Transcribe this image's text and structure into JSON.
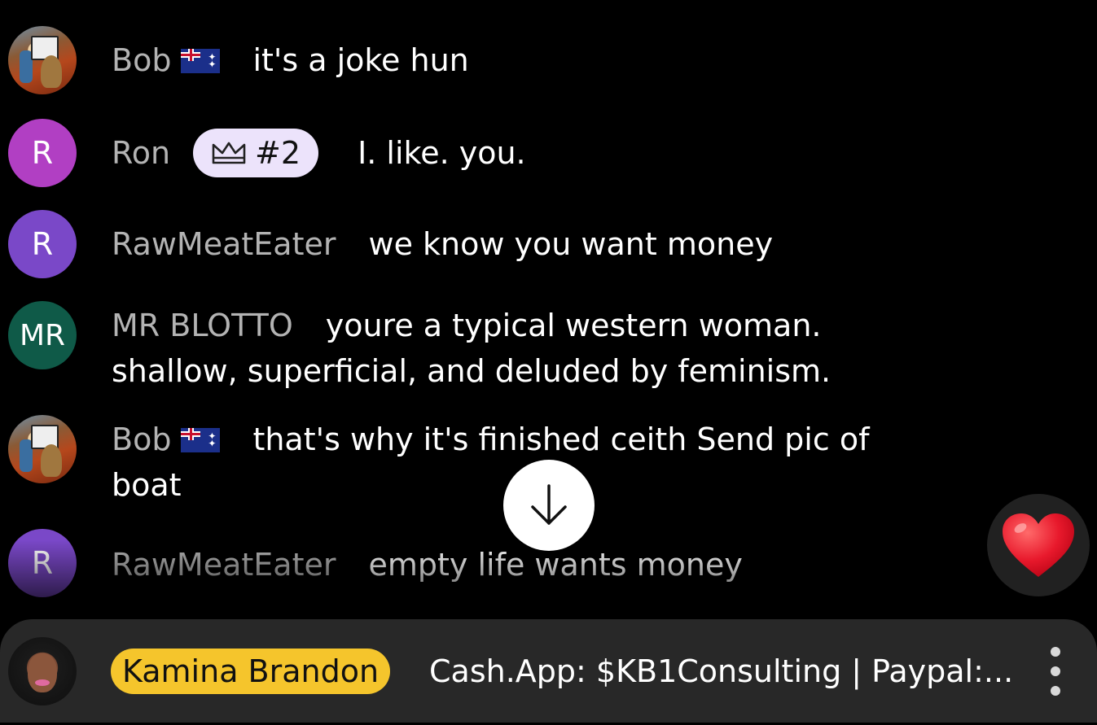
{
  "messages": [
    {
      "user": "Bob",
      "flag": "australia-flag",
      "text": "it's a joke hun",
      "avatar": "photo"
    },
    {
      "user": "Ron",
      "initial": "R",
      "avatar_color": "#b13fc3",
      "badge": "#2",
      "text": "I. like. you."
    },
    {
      "user": "RawMeatEater",
      "initial": "R",
      "avatar_color": "#7a48c8",
      "text": "we know you want money"
    },
    {
      "user": "MR BLOTTO",
      "initial": "MR",
      "avatar_color": "#0f5a48",
      "text": "youre a typical western woman. shallow, superficial, and deluded by feminism."
    },
    {
      "user": "Bob",
      "flag": "australia-flag",
      "text": "that's why it's finished ceith Send pic of boat",
      "avatar": "photo"
    },
    {
      "user": "RawMeatEater",
      "initial": "R",
      "avatar_color": "#7a48c8",
      "text": "empty life wants money"
    }
  ],
  "pinned": {
    "user": "Kamina Brandon",
    "text": "Cash.App: $KB1Consulting | Paypal:...",
    "tag_color": "#f5c52c"
  },
  "icons": {
    "scroll_down": "arrow-down-icon",
    "reaction": "heart-icon",
    "more": "more-vert-icon",
    "badge": "crown-icon"
  }
}
